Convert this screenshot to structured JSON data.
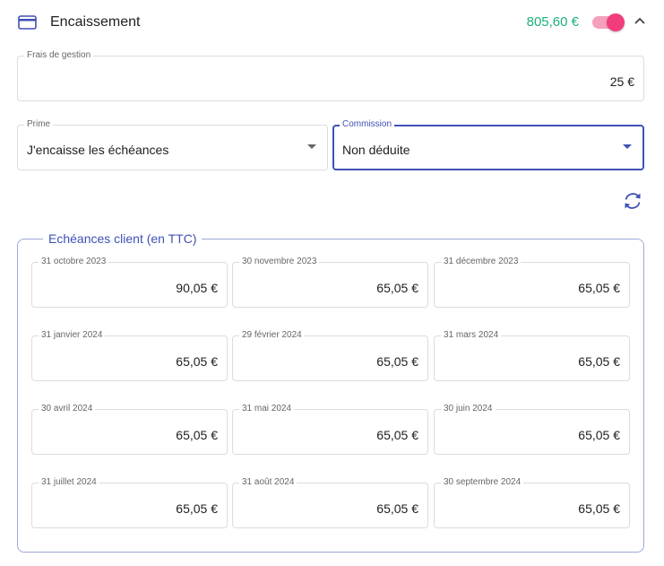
{
  "header": {
    "title": "Encaissement",
    "amount": "805,60 €",
    "toggle_on": true,
    "card_icon": "credit-card-icon",
    "collapse_icon": "chevron-up-icon"
  },
  "fees": {
    "label": "Frais de gestion",
    "value": "25 €"
  },
  "prime": {
    "label": "Prime",
    "value": "J'encaisse les échéances"
  },
  "commission": {
    "label": "Commission",
    "value": "Non déduite"
  },
  "refresh_icon": "refresh-icon",
  "colors": {
    "accent": "#3f51b5",
    "amount_green": "#1db07a",
    "toggle_pink": "#f23d7c"
  },
  "schedule": {
    "legend": "Echéances client (en TTC)",
    "items": [
      {
        "date": "31 octobre 2023",
        "amount": "90,05 €"
      },
      {
        "date": "30 novembre 2023",
        "amount": "65,05 €"
      },
      {
        "date": "31 décembre 2023",
        "amount": "65,05 €"
      },
      {
        "date": "31 janvier 2024",
        "amount": "65,05 €"
      },
      {
        "date": "29 février 2024",
        "amount": "65,05 €"
      },
      {
        "date": "31 mars 2024",
        "amount": "65,05 €"
      },
      {
        "date": "30 avril 2024",
        "amount": "65,05 €"
      },
      {
        "date": "31 mai 2024",
        "amount": "65,05 €"
      },
      {
        "date": "30 juin 2024",
        "amount": "65,05 €"
      },
      {
        "date": "31 juillet 2024",
        "amount": "65,05 €"
      },
      {
        "date": "31 août 2024",
        "amount": "65,05 €"
      },
      {
        "date": "30 septembre 2024",
        "amount": "65,05 €"
      }
    ]
  }
}
